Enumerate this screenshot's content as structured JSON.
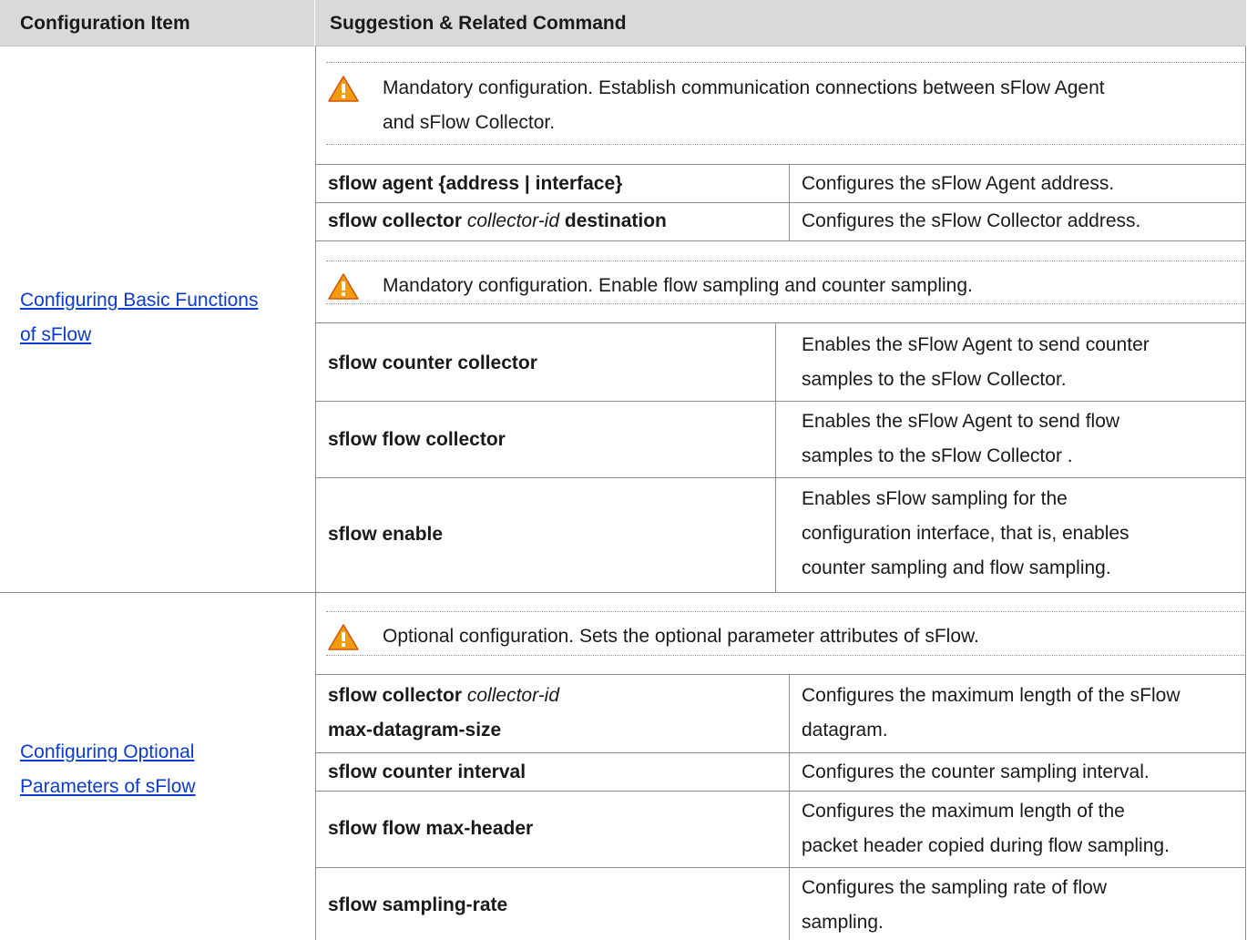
{
  "table": {
    "header": {
      "col1": "Configuration Item",
      "col2": "Suggestion & Related Command"
    },
    "sections": [
      {
        "item_line1": "Configuring Basic Functions ",
        "item_line2": "of sFlow",
        "note1_line1": "Mandatory configuration. Establish communication connections between sFlow Agent",
        "note1_line2": "and sFlow Collector.",
        "rows_a": [
          {
            "cmd": "sflow agent {address | interface}",
            "desc": "Configures the sFlow Agent address."
          },
          {
            "cmd_b1": "sflow collector",
            "cmd_i": "collector-id",
            "cmd_b2": "destination",
            "desc": "Configures the sFlow Collector address."
          }
        ],
        "note2": "Mandatory configuration. Enable flow sampling and counter sampling.",
        "rows_b": [
          {
            "cmd": "sflow counter collector",
            "desc1": "Enables the sFlow Agent to send counter",
            "desc2": "samples to the sFlow Collector."
          },
          {
            "cmd": "sflow flow collector",
            "desc1": "Enables the sFlow Agent to send flow",
            "desc2": "samples to the sFlow Collector ."
          },
          {
            "cmd": "sflow enable",
            "desc1": "Enables sFlow sampling for the",
            "desc2": "configuration interface, that is, enables",
            "desc3": "counter sampling and flow sampling."
          }
        ]
      },
      {
        "item_line1": "Configuring Optional ",
        "item_line2": "Parameters of sFlow",
        "note": "Optional configuration. Sets the optional parameter attributes of sFlow.",
        "rows": [
          {
            "cmd_b1": "sflow collector",
            "cmd_i": "collector-id",
            "cmd_line2": "max-datagram-size",
            "desc1": "Configures the maximum length of the sFlow",
            "desc2": "datagram."
          },
          {
            "cmd": "sflow counter interval",
            "desc1": "Configures the counter sampling interval."
          },
          {
            "cmd": "sflow flow max-header",
            "desc1": "Configures the maximum length of the",
            "desc2": "packet header copied during flow sampling."
          },
          {
            "cmd": "sflow sampling-rate",
            "desc1": "Configures the sampling rate of flow",
            "desc2": "sampling."
          }
        ]
      }
    ]
  },
  "icons": {
    "note": "warning-triangle-icon"
  },
  "colors": {
    "header_bg": "#d9d9d9",
    "link": "#0b3bd3",
    "warning": "#f39c12"
  }
}
